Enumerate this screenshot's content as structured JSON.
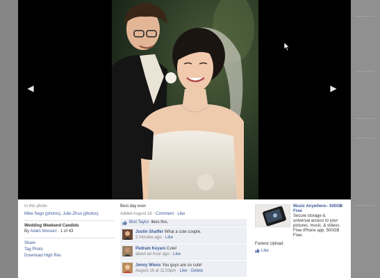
{
  "lightbox": {
    "nav": {
      "prev_glyph": "◀",
      "next_glyph": "▶"
    }
  },
  "sidebar": {
    "in_this_photo_label": "In this photo",
    "tagged_people": "Mike Sego (photos), Julie Zhuo (photos)",
    "album_title": "Wedding Weekend Candids",
    "album_by_prefix": "By",
    "album_owner": "Adam Mosseri",
    "album_position": "· 1 of 43",
    "actions": [
      "Share",
      "Tag Photo",
      "Download High Res"
    ]
  },
  "main": {
    "caption": "Best day ever.",
    "added_prefix": "Added August 16 ·",
    "comment_link": "Comment",
    "like_link": "Like",
    "likes_person": "Bret Taylor",
    "likes_suffix": "likes this.",
    "comments": [
      {
        "author": "Justin Shaffer",
        "text": "What a cute couple.",
        "time": "2 minutes ago",
        "actions": "· Like"
      },
      {
        "author": "Pedram Keyani",
        "text": "Cute!",
        "time": "about an hour ago",
        "actions": "· Like"
      },
      {
        "author": "Jenny Wiens",
        "text": "You guys are so cute!",
        "time": "August 16 at 11:03pm",
        "actions": "· Like · Delete"
      }
    ]
  },
  "ad": {
    "title": "Music Anywhere– 500GB Free",
    "body": "Secure storage & universal access to your pictures, music, & videos. Free iPhone app. 500GB Free.",
    "subtitle": "Fastest Upload.",
    "like_label": "Like",
    "close_glyph": "×"
  },
  "colors": {
    "link": "#3b5998",
    "comment_bg": "#edeff4",
    "stage": "#000000"
  }
}
